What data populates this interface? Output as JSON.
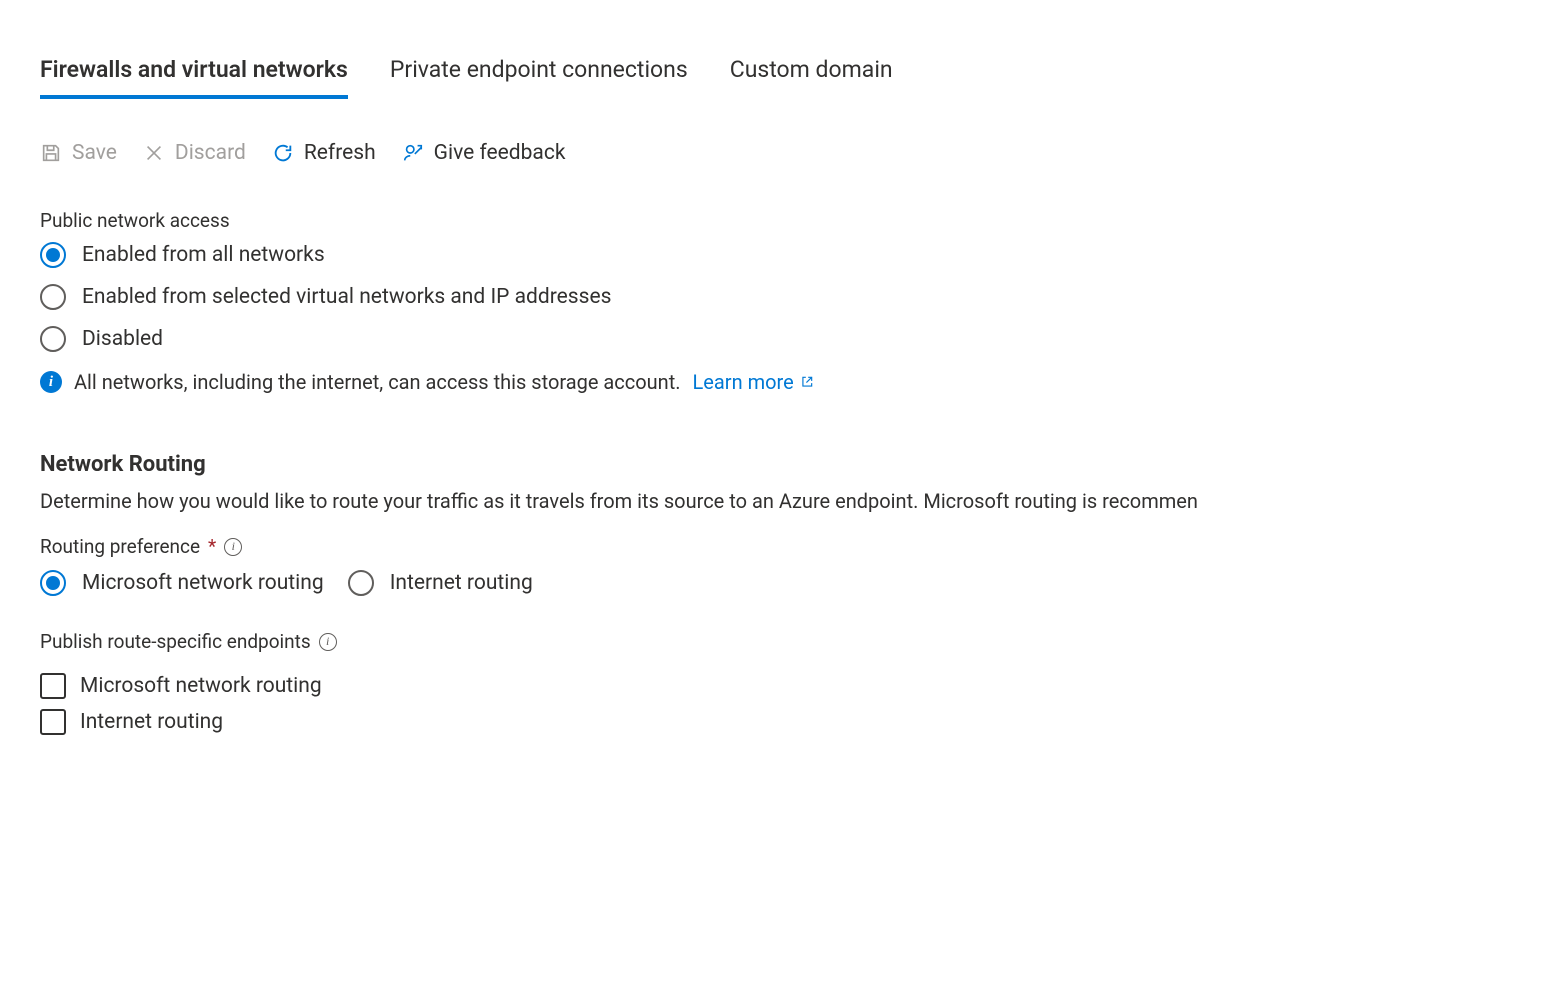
{
  "tabs": {
    "firewalls": "Firewalls and virtual networks",
    "private_endpoint": "Private endpoint connections",
    "custom_domain": "Custom domain"
  },
  "toolbar": {
    "save": "Save",
    "discard": "Discard",
    "refresh": "Refresh",
    "feedback": "Give feedback"
  },
  "public_access": {
    "label": "Public network access",
    "options": {
      "all": "Enabled from all networks",
      "selected": "Enabled from selected virtual networks and IP addresses",
      "disabled": "Disabled"
    },
    "info_text": "All networks, including the internet, can access this storage account.",
    "learn_more": "Learn more"
  },
  "network_routing": {
    "heading": "Network Routing",
    "description": "Determine how you would like to route your traffic as it travels from its source to an Azure endpoint. Microsoft routing is recommen",
    "preference_label": "Routing preference",
    "required_mark": "*",
    "options": {
      "microsoft": "Microsoft network routing",
      "internet": "Internet routing"
    },
    "publish_label": "Publish route-specific endpoints",
    "publish_options": {
      "microsoft": "Microsoft network routing",
      "internet": "Internet routing"
    }
  }
}
